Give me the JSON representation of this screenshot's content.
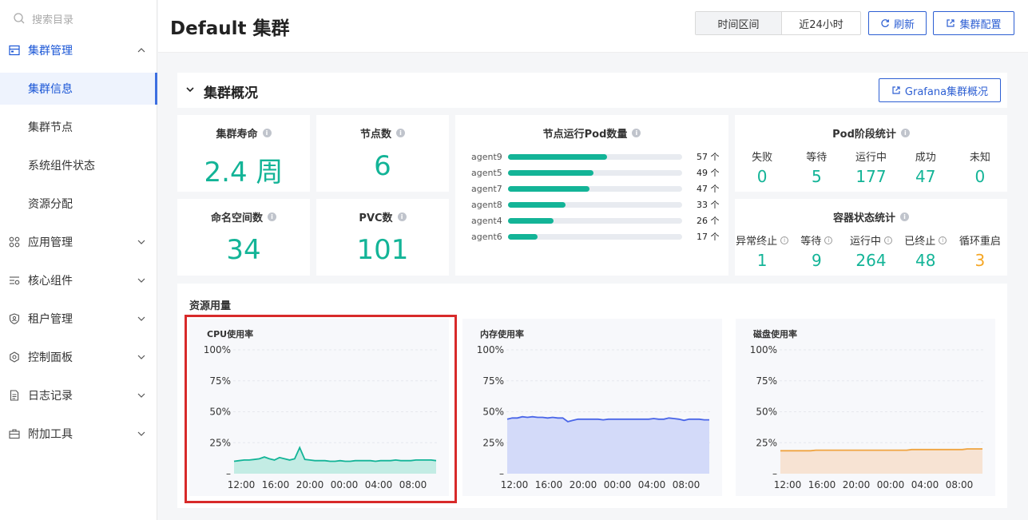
{
  "sidebar": {
    "search_placeholder": "搜索目录",
    "group_cluster": "集群管理",
    "sub_items": [
      "集群信息",
      "集群节点",
      "系统组件状态",
      "资源分配"
    ],
    "items": [
      "应用管理",
      "核心组件",
      "租户管理",
      "控制面板",
      "日志记录",
      "附加工具"
    ]
  },
  "header": {
    "title": "Default 集群",
    "time_label": "时间区间",
    "time_value": "近24小时",
    "refresh": "刷新",
    "cluster_config": "集群配置"
  },
  "overview": {
    "title": "集群概况",
    "grafana_btn": "Grafana集群概况",
    "lifetime": {
      "label": "集群寿命",
      "value": "2.4 周"
    },
    "nodes": {
      "label": "节点数",
      "value": "6"
    },
    "namespaces": {
      "label": "命名空间数",
      "value": "34"
    },
    "pvc": {
      "label": "PVC数",
      "value": "101"
    },
    "pod_per_node": {
      "label": "节点运行Pod数量",
      "rows": [
        {
          "name": "agent9",
          "value": 57,
          "text": "57 个"
        },
        {
          "name": "agent5",
          "value": 49,
          "text": "49 个"
        },
        {
          "name": "agent7",
          "value": 47,
          "text": "47 个"
        },
        {
          "name": "agent8",
          "value": 33,
          "text": "33 个"
        },
        {
          "name": "agent4",
          "value": 26,
          "text": "26 个"
        },
        {
          "name": "agent6",
          "value": 17,
          "text": "17 个"
        }
      ],
      "max": 100
    },
    "pod_phase": {
      "label": "Pod阶段统计",
      "items": [
        {
          "label": "失败",
          "value": "0"
        },
        {
          "label": "等待",
          "value": "5"
        },
        {
          "label": "运行中",
          "value": "177"
        },
        {
          "label": "成功",
          "value": "47"
        },
        {
          "label": "未知",
          "value": "0"
        }
      ]
    },
    "container_state": {
      "label": "容器状态统计",
      "items": [
        {
          "label": "异常终止",
          "value": "1"
        },
        {
          "label": "等待",
          "value": "9"
        },
        {
          "label": "运行中",
          "value": "264"
        },
        {
          "label": "已终止",
          "value": "48"
        },
        {
          "label": "循环重启",
          "value": "3"
        }
      ]
    }
  },
  "resources": {
    "title": "资源用量"
  },
  "chart_data": [
    {
      "type": "area",
      "title": "CPU使用率",
      "x": [
        "12:00",
        "16:00",
        "20:00",
        "00:00",
        "04:00",
        "08:00"
      ],
      "yticks": [
        "100%",
        "75%",
        "50%",
        "25%",
        "–"
      ],
      "ylim": [
        0,
        100
      ],
      "color": "#13b497",
      "fill": "#c3ece4",
      "values": [
        10,
        10.5,
        11,
        11,
        11.5,
        12,
        13.5,
        12,
        11,
        13,
        12,
        11,
        12,
        21,
        11.5,
        11,
        10.5,
        10.5,
        10.5,
        10,
        10,
        10.5,
        10,
        10,
        10.5,
        10.5,
        10.5,
        10.5,
        10,
        10.5,
        10.5,
        10.5,
        11,
        10.5,
        10.5,
        10.5,
        11,
        11,
        11,
        11,
        10.5
      ]
    },
    {
      "type": "area",
      "title": "内存使用率",
      "x": [
        "12:00",
        "16:00",
        "20:00",
        "00:00",
        "04:00",
        "08:00"
      ],
      "yticks": [
        "100%",
        "75%",
        "50%",
        "25%",
        "–"
      ],
      "ylim": [
        0,
        100
      ],
      "color": "#4a66e8",
      "fill": "#d3daf9",
      "values": [
        44,
        45,
        45,
        46,
        45.5,
        46,
        45.5,
        45.5,
        45,
        45.5,
        45,
        45,
        42,
        43,
        44,
        44,
        44,
        44,
        44,
        43.5,
        44,
        44,
        44,
        44,
        44,
        44,
        44,
        44,
        44,
        44.5,
        44,
        44,
        45,
        44.5,
        44,
        43,
        44,
        44,
        44,
        43.5,
        43.5
      ]
    },
    {
      "type": "area",
      "title": "磁盘使用率",
      "x": [
        "12:00",
        "16:00",
        "20:00",
        "00:00",
        "04:00",
        "08:00"
      ],
      "yticks": [
        "100%",
        "75%",
        "50%",
        "25%",
        "–"
      ],
      "ylim": [
        0,
        100
      ],
      "color": "#f0a440",
      "fill": "#f7e3d3",
      "values": [
        18.5,
        18.5,
        18.5,
        18.5,
        18.5,
        18.5,
        18.5,
        19,
        19,
        19,
        19,
        19,
        19,
        19,
        19,
        19,
        19,
        19,
        19,
        19,
        19,
        19,
        19,
        19,
        19,
        19,
        19.5,
        19.5,
        19.5,
        19.5,
        19.5,
        19.5,
        19.5,
        19.5,
        19.5,
        19.5,
        19.5,
        20,
        20,
        20,
        20
      ]
    }
  ]
}
